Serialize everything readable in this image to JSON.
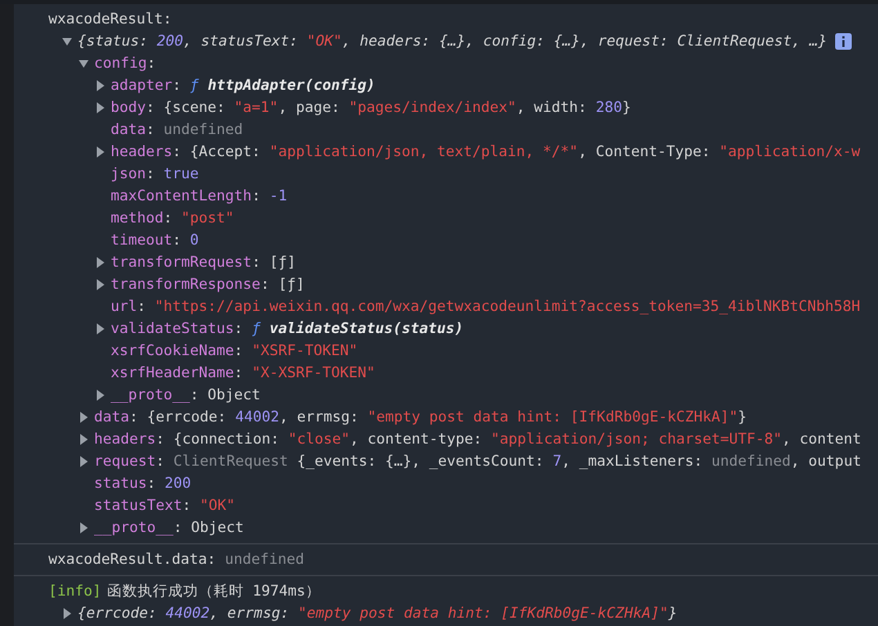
{
  "messages": [
    {
      "header": [
        {
          "kind": "plain",
          "text": "wxacodeResult:"
        }
      ],
      "root": {
        "expanded": true,
        "italic": true,
        "info_badge": true,
        "parts": [
          {
            "kind": "plain",
            "text": "{status: "
          },
          {
            "kind": "num",
            "text": "200"
          },
          {
            "kind": "plain",
            "text": ", statusText: "
          },
          {
            "kind": "str",
            "text": "\"OK\""
          },
          {
            "kind": "plain",
            "text": ", headers: {…}, config: {…}, request: ClientRequest, …}"
          }
        ],
        "children": [
          {
            "expanded": true,
            "parts": [
              {
                "kind": "key",
                "text": "config"
              },
              {
                "kind": "plain",
                "text": ":"
              }
            ],
            "children": [
              {
                "expanded": false,
                "parts": [
                  {
                    "kind": "key",
                    "text": "adapter"
                  },
                  {
                    "kind": "plain",
                    "text": ": "
                  },
                  {
                    "kind": "fn",
                    "text": "ƒ"
                  },
                  {
                    "kind": "sig",
                    "text": " httpAdapter(config)"
                  }
                ]
              },
              {
                "expanded": false,
                "parts": [
                  {
                    "kind": "key",
                    "text": "body"
                  },
                  {
                    "kind": "plain",
                    "text": ": {scene: "
                  },
                  {
                    "kind": "str",
                    "text": "\"a=1\""
                  },
                  {
                    "kind": "plain",
                    "text": ", page: "
                  },
                  {
                    "kind": "str",
                    "text": "\"pages/index/index\""
                  },
                  {
                    "kind": "plain",
                    "text": ", width: "
                  },
                  {
                    "kind": "num",
                    "text": "280"
                  },
                  {
                    "kind": "plain",
                    "text": "}"
                  }
                ]
              },
              {
                "parts": [
                  {
                    "kind": "key",
                    "text": "data"
                  },
                  {
                    "kind": "plain",
                    "text": ": "
                  },
                  {
                    "kind": "undef",
                    "text": "undefined"
                  }
                ]
              },
              {
                "expanded": false,
                "parts": [
                  {
                    "kind": "key",
                    "text": "headers"
                  },
                  {
                    "kind": "plain",
                    "text": ": {Accept: "
                  },
                  {
                    "kind": "str",
                    "text": "\"application/json, text/plain, */*\""
                  },
                  {
                    "kind": "plain",
                    "text": ", Content-Type: "
                  },
                  {
                    "kind": "str",
                    "text": "\"application/x-w"
                  }
                ]
              },
              {
                "parts": [
                  {
                    "kind": "key",
                    "text": "json"
                  },
                  {
                    "kind": "plain",
                    "text": ": "
                  },
                  {
                    "kind": "num",
                    "text": "true"
                  }
                ]
              },
              {
                "parts": [
                  {
                    "kind": "key",
                    "text": "maxContentLength"
                  },
                  {
                    "kind": "plain",
                    "text": ": "
                  },
                  {
                    "kind": "num",
                    "text": "-1"
                  }
                ]
              },
              {
                "parts": [
                  {
                    "kind": "key",
                    "text": "method"
                  },
                  {
                    "kind": "plain",
                    "text": ": "
                  },
                  {
                    "kind": "str",
                    "text": "\"post\""
                  }
                ]
              },
              {
                "parts": [
                  {
                    "kind": "key",
                    "text": "timeout"
                  },
                  {
                    "kind": "plain",
                    "text": ": "
                  },
                  {
                    "kind": "num",
                    "text": "0"
                  }
                ]
              },
              {
                "expanded": false,
                "parts": [
                  {
                    "kind": "key",
                    "text": "transformRequest"
                  },
                  {
                    "kind": "plain",
                    "text": ": [ƒ]"
                  }
                ]
              },
              {
                "expanded": false,
                "parts": [
                  {
                    "kind": "key",
                    "text": "transformResponse"
                  },
                  {
                    "kind": "plain",
                    "text": ": [ƒ]"
                  }
                ]
              },
              {
                "parts": [
                  {
                    "kind": "key",
                    "text": "url"
                  },
                  {
                    "kind": "plain",
                    "text": ": "
                  },
                  {
                    "kind": "str",
                    "text": "\"https://api.weixin.qq.com/wxa/getwxacodeunlimit?access_token=35_4iblNKBtCNbh58H"
                  }
                ]
              },
              {
                "expanded": false,
                "parts": [
                  {
                    "kind": "key",
                    "text": "validateStatus"
                  },
                  {
                    "kind": "plain",
                    "text": ": "
                  },
                  {
                    "kind": "fn",
                    "text": "ƒ"
                  },
                  {
                    "kind": "sig",
                    "text": " validateStatus(status)"
                  }
                ]
              },
              {
                "parts": [
                  {
                    "kind": "key",
                    "text": "xsrfCookieName"
                  },
                  {
                    "kind": "plain",
                    "text": ": "
                  },
                  {
                    "kind": "str",
                    "text": "\"XSRF-TOKEN\""
                  }
                ]
              },
              {
                "parts": [
                  {
                    "kind": "key",
                    "text": "xsrfHeaderName"
                  },
                  {
                    "kind": "plain",
                    "text": ": "
                  },
                  {
                    "kind": "str",
                    "text": "\"X-XSRF-TOKEN\""
                  }
                ]
              },
              {
                "expanded": false,
                "parts": [
                  {
                    "kind": "key",
                    "text": "__proto__"
                  },
                  {
                    "kind": "plain",
                    "text": ": Object"
                  }
                ]
              }
            ]
          },
          {
            "expanded": false,
            "parts": [
              {
                "kind": "key",
                "text": "data"
              },
              {
                "kind": "plain",
                "text": ": {errcode: "
              },
              {
                "kind": "num",
                "text": "44002"
              },
              {
                "kind": "plain",
                "text": ", errmsg: "
              },
              {
                "kind": "str",
                "text": "\"empty post data hint: [IfKdRb0gE-kCZHkA]\""
              },
              {
                "kind": "plain",
                "text": "}"
              }
            ]
          },
          {
            "expanded": false,
            "parts": [
              {
                "kind": "key",
                "text": "headers"
              },
              {
                "kind": "plain",
                "text": ": {connection: "
              },
              {
                "kind": "str",
                "text": "\"close\""
              },
              {
                "kind": "plain",
                "text": ", content-type: "
              },
              {
                "kind": "str",
                "text": "\"application/json; charset=UTF-8\""
              },
              {
                "kind": "plain",
                "text": ", content"
              }
            ]
          },
          {
            "expanded": false,
            "parts": [
              {
                "kind": "key",
                "text": "request"
              },
              {
                "kind": "plain",
                "text": ": "
              },
              {
                "kind": "undef",
                "text": "ClientRequest"
              },
              {
                "kind": "plain",
                "text": " {_events: {…}, _eventsCount: "
              },
              {
                "kind": "num",
                "text": "7"
              },
              {
                "kind": "plain",
                "text": ", _maxListeners: "
              },
              {
                "kind": "undef",
                "text": "undefined"
              },
              {
                "kind": "plain",
                "text": ", output"
              }
            ]
          },
          {
            "parts": [
              {
                "kind": "key",
                "text": "status"
              },
              {
                "kind": "plain",
                "text": ": "
              },
              {
                "kind": "num",
                "text": "200"
              }
            ]
          },
          {
            "parts": [
              {
                "kind": "key",
                "text": "statusText"
              },
              {
                "kind": "plain",
                "text": ": "
              },
              {
                "kind": "str",
                "text": "\"OK\""
              }
            ]
          },
          {
            "expanded": false,
            "parts": [
              {
                "kind": "key",
                "text": "__proto__"
              },
              {
                "kind": "plain",
                "text": ": Object"
              }
            ]
          }
        ]
      }
    },
    {
      "header": [
        {
          "kind": "plain",
          "text": "wxacodeResult.data: "
        },
        {
          "kind": "undef",
          "text": "undefined"
        }
      ]
    },
    {
      "header": [
        {
          "kind": "tag",
          "text": "[info]"
        },
        {
          "kind": "plain",
          "text": "函数执行成功（耗时 1974ms）"
        }
      ],
      "root": {
        "expanded": false,
        "italic": true,
        "parts": [
          {
            "kind": "plain",
            "text": "{errcode: "
          },
          {
            "kind": "num",
            "text": "44002"
          },
          {
            "kind": "plain",
            "text": ", errmsg: "
          },
          {
            "kind": "str",
            "text": "\"empty post data hint: [IfKdRb0gE-kCZHkA]\""
          },
          {
            "kind": "plain",
            "text": "}"
          }
        ]
      }
    }
  ]
}
